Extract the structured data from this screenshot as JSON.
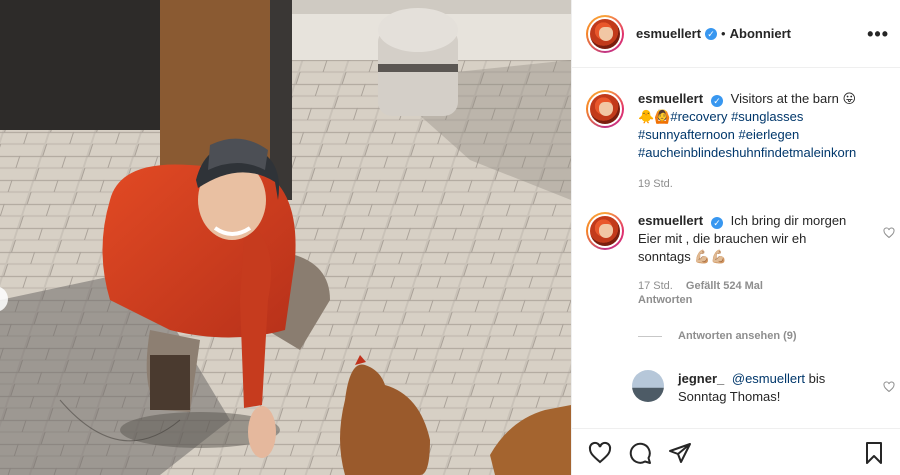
{
  "header": {
    "username": "esmuellert",
    "dot": "•",
    "follow_label": "Abonniert",
    "more_label": "•••"
  },
  "caption": {
    "username": "esmuellert",
    "text": "Visitors at the barn",
    "emoji_end": "😛",
    "emoji_start": "🐥🙆",
    "hashtags": [
      "#recovery",
      "#sunglasses",
      "#sunnyafternoon",
      "#eierlegen",
      "#aucheinblindeshuhnfindetmaleinkorn"
    ],
    "time": "19 Std."
  },
  "comment": {
    "username": "esmuellert",
    "text": "Ich bring dir morgen Eier mit , die brauchen wir eh sonntags",
    "emoji": "💪🏼💪🏼",
    "time": "17 Std.",
    "likes": "Gefällt 524 Mal",
    "reply_label": "Antworten",
    "view_replies": "Antworten ansehen (9)"
  },
  "reply": {
    "username": "jegner_",
    "mention": "@esmuellert",
    "text": "bis Sonntag Thomas!"
  },
  "icons": {
    "like": "heart-icon",
    "comment": "comment-icon",
    "share": "share-icon",
    "save": "bookmark-icon",
    "verified": "verified-icon"
  },
  "colors": {
    "link": "#00376b",
    "verified": "#3897f0",
    "muted": "#8e8e8e"
  }
}
